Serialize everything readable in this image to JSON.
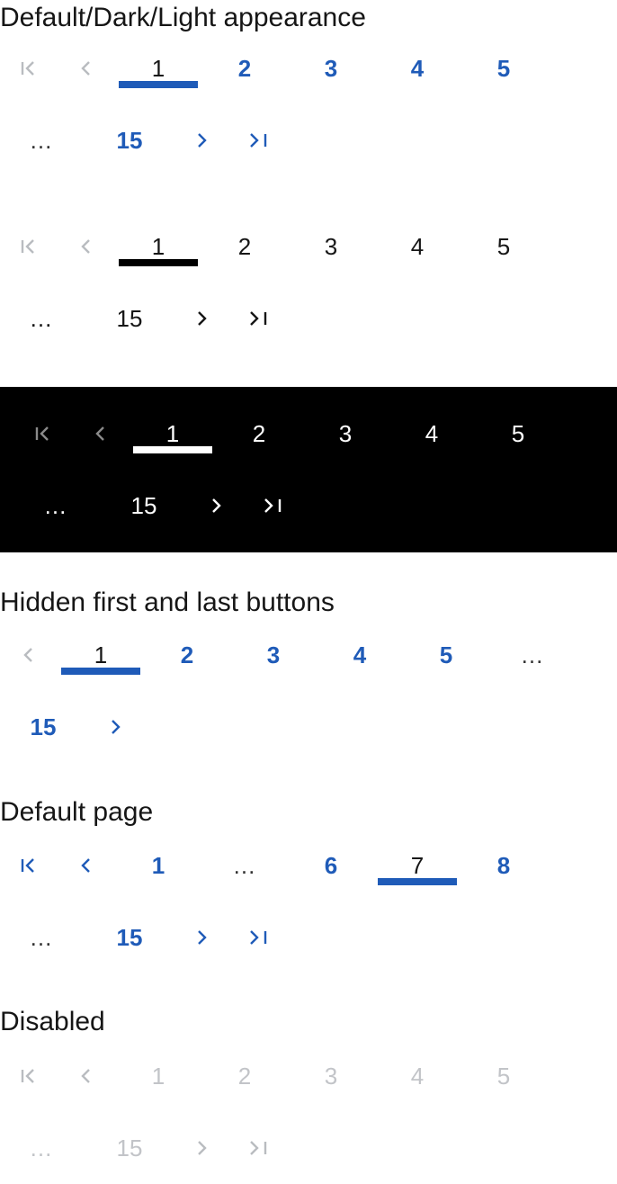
{
  "sections": {
    "appearance": {
      "title": "Default/Dark/Light appearance"
    },
    "hidden": {
      "title": "Hidden first and last buttons"
    },
    "default_page": {
      "title": "Default page"
    },
    "disabled": {
      "title": "Disabled"
    }
  },
  "icons": {
    "first": "first-page-icon",
    "previous": "chevron-left-icon",
    "next": "chevron-right-icon",
    "last": "last-page-icon"
  },
  "colors": {
    "accent": "#1f5bb8",
    "text": "#161616",
    "disabled": "#b9bcc0",
    "dark_background": "#000000"
  },
  "paginations": {
    "default": {
      "row1": [
        "1",
        "2",
        "3",
        "4",
        "5"
      ],
      "row2": {
        "ellipsis": "...",
        "last_page": "15"
      },
      "selected_page": "1"
    },
    "light": {
      "row1": [
        "1",
        "2",
        "3",
        "4",
        "5"
      ],
      "row2": {
        "ellipsis": "...",
        "last_page": "15"
      },
      "selected_page": "1"
    },
    "dark": {
      "row1": [
        "1",
        "2",
        "3",
        "4",
        "5"
      ],
      "row2": {
        "ellipsis": "...",
        "last_page": "15"
      },
      "selected_page": "1"
    },
    "hidden": {
      "row1": [
        "1",
        "2",
        "3",
        "4",
        "5",
        "..."
      ],
      "row2": {
        "last_page": "15"
      },
      "selected_page": "1"
    },
    "default_page": {
      "row1": [
        "1",
        "...",
        "6",
        "7",
        "8"
      ],
      "row2": {
        "ellipsis": "...",
        "last_page": "15"
      },
      "selected_page": "7"
    },
    "disabled": {
      "row1": [
        "1",
        "2",
        "3",
        "4",
        "5"
      ],
      "row2": {
        "ellipsis": "...",
        "last_page": "15"
      },
      "selected_page": ""
    }
  }
}
